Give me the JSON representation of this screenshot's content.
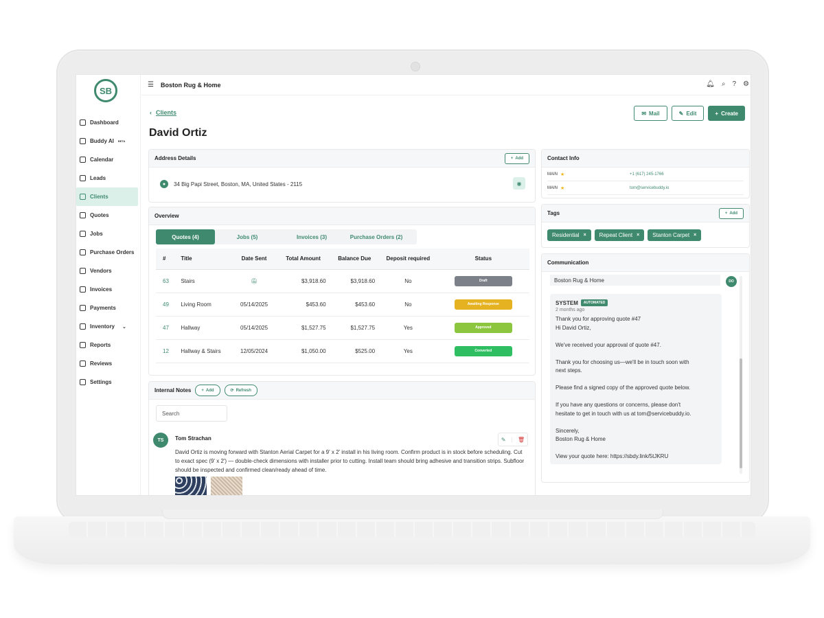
{
  "header": {
    "company": "Boston Rug & Home"
  },
  "sidebar": {
    "logo": "SB",
    "items": [
      {
        "label": "Dashboard",
        "icon": "dashboard-icon"
      },
      {
        "label": "Buddy AI",
        "badge": "BETA",
        "icon": "robot-icon"
      },
      {
        "label": "Calendar",
        "icon": "calendar-icon"
      },
      {
        "label": "Leads",
        "icon": "leads-icon"
      },
      {
        "label": "Clients",
        "icon": "users-icon",
        "active": true
      },
      {
        "label": "Quotes",
        "icon": "quote-icon"
      },
      {
        "label": "Jobs",
        "icon": "briefcase-icon"
      },
      {
        "label": "Purchase Orders",
        "icon": "purchase-order-icon"
      },
      {
        "label": "Vendors",
        "icon": "vendor-icon"
      },
      {
        "label": "Invoices",
        "icon": "invoice-icon"
      },
      {
        "label": "Payments",
        "icon": "payment-icon"
      },
      {
        "label": "Inventory",
        "icon": "inventory-icon"
      },
      {
        "label": "Reports",
        "icon": "report-icon"
      },
      {
        "label": "Reviews",
        "icon": "star-icon"
      },
      {
        "label": "Settings",
        "icon": "gear-icon"
      }
    ]
  },
  "page": {
    "back_label": "Clients",
    "title": "David Ortiz",
    "actions": {
      "mail": "Mail",
      "edit": "Edit",
      "create": "Create"
    }
  },
  "address": {
    "title": "Address Details",
    "add": "Add",
    "line": "34 Big Papi Street, Boston, MA, United States - 2115"
  },
  "overview": {
    "title": "Overview",
    "tabs": [
      "Quotes (4)",
      "Jobs (5)",
      "Invoices (3)",
      "Purchase Orders (2)"
    ],
    "columns": [
      "#",
      "Title",
      "Date Sent",
      "Total Amount",
      "Balance Due",
      "Deposit required",
      "Status"
    ],
    "rows": [
      {
        "num": "63",
        "title": "Stairs",
        "date": "",
        "total": "$3,918.60",
        "balance": "$3,918.60",
        "deposit": "No",
        "status": "Draft",
        "color": "#7b8089"
      },
      {
        "num": "49",
        "title": "Living Room",
        "date": "05/14/2025",
        "total": "$453.60",
        "balance": "$453.60",
        "deposit": "No",
        "status": "Awaiting Response",
        "color": "#e5b321"
      },
      {
        "num": "47",
        "title": "Hallway",
        "date": "05/14/2025",
        "total": "$1,527.75",
        "balance": "$1,527.75",
        "deposit": "Yes",
        "status": "Approved",
        "color": "#8cc63f"
      },
      {
        "num": "12",
        "title": "Hallway & Stairs",
        "date": "12/05/2024",
        "total": "$1,050.00",
        "balance": "$525.00",
        "deposit": "Yes",
        "status": "Converted",
        "color": "#2fbf62"
      }
    ]
  },
  "notes": {
    "title": "Internal Notes",
    "add": "Add",
    "refresh": "Refresh",
    "search_placeholder": "Search",
    "author_initials": "TS",
    "author": "Tom Strachan",
    "text": "David Ortiz is moving forward with Stanton Aerial Carpet for a 9' x 2' install in his living room. Confirm product is in stock before scheduling. Cut to exact spec (9' x 2') — double-check dimensions with installer prior to cutting. Install team should bring adhesive and transition strips. Subfloor should be inspected and confirmed clean/ready ahead of time."
  },
  "contact": {
    "title": "Contact Info",
    "rows": [
      {
        "label": "MAIN",
        "value": "+1 (617) 245-1766"
      },
      {
        "label": "MAIN",
        "value": "tom@servicebuddy.io"
      }
    ]
  },
  "tags": {
    "title": "Tags",
    "add": "Add",
    "items": [
      "Residential",
      "Repeat Client",
      "Stanton Carpet"
    ]
  },
  "communication": {
    "title": "Communication",
    "prev_message": "Boston Rug & Home",
    "sender": "SYSTEM",
    "badge": "AUTOMATED",
    "time": "2 months ago",
    "avatar": "DO",
    "lines": [
      "Thank you for approving quote #47",
      "Hi David Ortiz,",
      "",
      "We've received your approval of quote #47.",
      "",
      "Thank you for choosing us—we'll be in touch soon with",
      "next steps.",
      "",
      "Please find a signed copy of the approved quote below.",
      "",
      "If you have any questions or concerns, please don't",
      "hesitate to get in touch with us at tom@servicebuddy.io.",
      "",
      "Sincerely,",
      "Boston Rug & Home",
      "",
      "View your quote here: https://sbdy.link/5tJKRU"
    ]
  }
}
